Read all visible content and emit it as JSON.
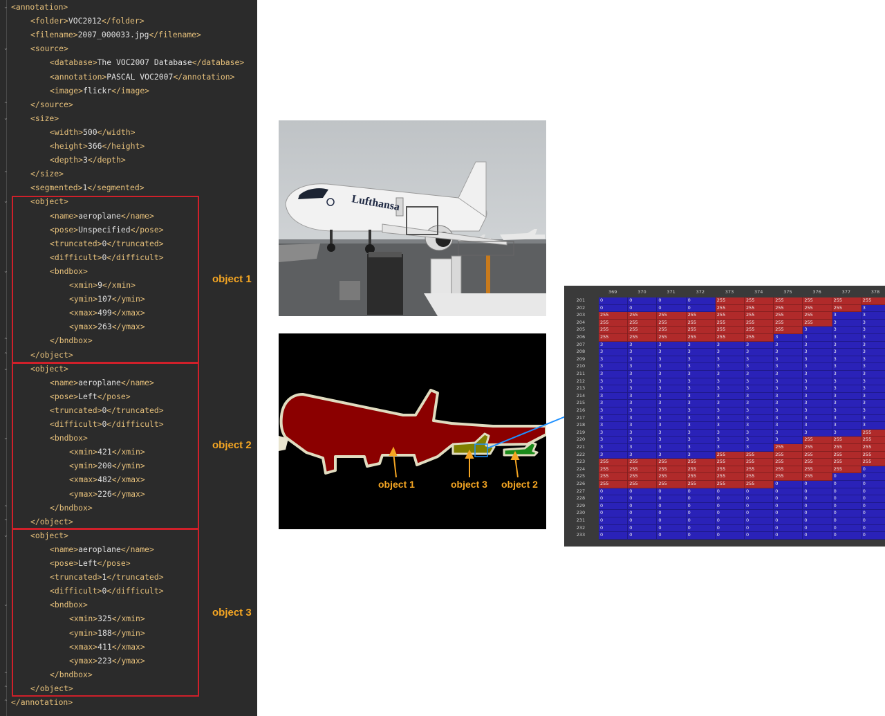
{
  "code_lines": [
    {
      "indent": 0,
      "parts": [
        [
          "tag",
          "<annotation>"
        ]
      ]
    },
    {
      "indent": 1,
      "parts": [
        [
          "tag",
          "<folder>"
        ],
        [
          "txt",
          "VOC2012"
        ],
        [
          "tag",
          "</folder>"
        ]
      ]
    },
    {
      "indent": 1,
      "parts": [
        [
          "tag",
          "<filename>"
        ],
        [
          "txt",
          "2007_000033.jpg"
        ],
        [
          "tag",
          "</filename>"
        ]
      ]
    },
    {
      "indent": 1,
      "parts": [
        [
          "tag",
          "<source>"
        ]
      ]
    },
    {
      "indent": 2,
      "parts": [
        [
          "tag",
          "<database>"
        ],
        [
          "txt",
          "The VOC2007 Database"
        ],
        [
          "tag",
          "</database>"
        ]
      ]
    },
    {
      "indent": 2,
      "parts": [
        [
          "tag",
          "<annotation>"
        ],
        [
          "txt",
          "PASCAL VOC2007"
        ],
        [
          "tag",
          "</annotation>"
        ]
      ]
    },
    {
      "indent": 2,
      "parts": [
        [
          "tag",
          "<image>"
        ],
        [
          "txt",
          "flickr"
        ],
        [
          "tag",
          "</image>"
        ]
      ]
    },
    {
      "indent": 1,
      "parts": [
        [
          "tag",
          "</source>"
        ]
      ]
    },
    {
      "indent": 1,
      "parts": [
        [
          "tag",
          "<size>"
        ]
      ]
    },
    {
      "indent": 2,
      "parts": [
        [
          "tag",
          "<width>"
        ],
        [
          "txt",
          "500"
        ],
        [
          "tag",
          "</width>"
        ]
      ]
    },
    {
      "indent": 2,
      "parts": [
        [
          "tag",
          "<height>"
        ],
        [
          "txt",
          "366"
        ],
        [
          "tag",
          "</height>"
        ]
      ]
    },
    {
      "indent": 2,
      "parts": [
        [
          "tag",
          "<depth>"
        ],
        [
          "txt",
          "3"
        ],
        [
          "tag",
          "</depth>"
        ]
      ]
    },
    {
      "indent": 1,
      "parts": [
        [
          "tag",
          "</size>"
        ]
      ]
    },
    {
      "indent": 1,
      "parts": [
        [
          "tag",
          "<segmented>"
        ],
        [
          "txt",
          "1"
        ],
        [
          "tag",
          "</segmented>"
        ]
      ]
    },
    {
      "indent": 1,
      "parts": [
        [
          "tag",
          "<object>"
        ]
      ]
    },
    {
      "indent": 2,
      "parts": [
        [
          "tag",
          "<name>"
        ],
        [
          "txt",
          "aeroplane"
        ],
        [
          "tag",
          "</name>"
        ]
      ]
    },
    {
      "indent": 2,
      "parts": [
        [
          "tag",
          "<pose>"
        ],
        [
          "txt",
          "Unspecified"
        ],
        [
          "tag",
          "</pose>"
        ]
      ]
    },
    {
      "indent": 2,
      "parts": [
        [
          "tag",
          "<truncated>"
        ],
        [
          "txt",
          "0"
        ],
        [
          "tag",
          "</truncated>"
        ]
      ]
    },
    {
      "indent": 2,
      "parts": [
        [
          "tag",
          "<difficult>"
        ],
        [
          "txt",
          "0"
        ],
        [
          "tag",
          "</difficult>"
        ]
      ]
    },
    {
      "indent": 2,
      "parts": [
        [
          "tag",
          "<bndbox>"
        ]
      ]
    },
    {
      "indent": 3,
      "parts": [
        [
          "tag",
          "<xmin>"
        ],
        [
          "txt",
          "9"
        ],
        [
          "tag",
          "</xmin>"
        ]
      ]
    },
    {
      "indent": 3,
      "parts": [
        [
          "tag",
          "<ymin>"
        ],
        [
          "txt",
          "107"
        ],
        [
          "tag",
          "</ymin>"
        ]
      ]
    },
    {
      "indent": 3,
      "parts": [
        [
          "tag",
          "<xmax>"
        ],
        [
          "txt",
          "499"
        ],
        [
          "tag",
          "</xmax>"
        ]
      ]
    },
    {
      "indent": 3,
      "parts": [
        [
          "tag",
          "<ymax>"
        ],
        [
          "txt",
          "263"
        ],
        [
          "tag",
          "</ymax>"
        ]
      ]
    },
    {
      "indent": 2,
      "parts": [
        [
          "tag",
          "</bndbox>"
        ]
      ]
    },
    {
      "indent": 1,
      "parts": [
        [
          "tag",
          "</object>"
        ]
      ]
    },
    {
      "indent": 1,
      "parts": [
        [
          "tag",
          "<object>"
        ]
      ]
    },
    {
      "indent": 2,
      "parts": [
        [
          "tag",
          "<name>"
        ],
        [
          "txt",
          "aeroplane"
        ],
        [
          "tag",
          "</name>"
        ]
      ]
    },
    {
      "indent": 2,
      "parts": [
        [
          "tag",
          "<pose>"
        ],
        [
          "txt",
          "Left"
        ],
        [
          "tag",
          "</pose>"
        ]
      ]
    },
    {
      "indent": 2,
      "parts": [
        [
          "tag",
          "<truncated>"
        ],
        [
          "txt",
          "0"
        ],
        [
          "tag",
          "</truncated>"
        ]
      ]
    },
    {
      "indent": 2,
      "parts": [
        [
          "tag",
          "<difficult>"
        ],
        [
          "txt",
          "0"
        ],
        [
          "tag",
          "</difficult>"
        ]
      ]
    },
    {
      "indent": 2,
      "parts": [
        [
          "tag",
          "<bndbox>"
        ]
      ]
    },
    {
      "indent": 3,
      "parts": [
        [
          "tag",
          "<xmin>"
        ],
        [
          "txt",
          "421"
        ],
        [
          "tag",
          "</xmin>"
        ]
      ]
    },
    {
      "indent": 3,
      "parts": [
        [
          "tag",
          "<ymin>"
        ],
        [
          "txt",
          "200"
        ],
        [
          "tag",
          "</ymin>"
        ]
      ]
    },
    {
      "indent": 3,
      "parts": [
        [
          "tag",
          "<xmax>"
        ],
        [
          "txt",
          "482"
        ],
        [
          "tag",
          "</xmax>"
        ]
      ]
    },
    {
      "indent": 3,
      "parts": [
        [
          "tag",
          "<ymax>"
        ],
        [
          "txt",
          "226"
        ],
        [
          "tag",
          "</ymax>"
        ]
      ]
    },
    {
      "indent": 2,
      "parts": [
        [
          "tag",
          "</bndbox>"
        ]
      ]
    },
    {
      "indent": 1,
      "parts": [
        [
          "tag",
          "</object>"
        ]
      ]
    },
    {
      "indent": 1,
      "parts": [
        [
          "tag",
          "<object>"
        ]
      ]
    },
    {
      "indent": 2,
      "parts": [
        [
          "tag",
          "<name>"
        ],
        [
          "txt",
          "aeroplane"
        ],
        [
          "tag",
          "</name>"
        ]
      ]
    },
    {
      "indent": 2,
      "parts": [
        [
          "tag",
          "<pose>"
        ],
        [
          "txt",
          "Left"
        ],
        [
          "tag",
          "</pose>"
        ]
      ]
    },
    {
      "indent": 2,
      "parts": [
        [
          "tag",
          "<truncated>"
        ],
        [
          "txt",
          "1"
        ],
        [
          "tag",
          "</truncated>"
        ]
      ]
    },
    {
      "indent": 2,
      "parts": [
        [
          "tag",
          "<difficult>"
        ],
        [
          "txt",
          "0"
        ],
        [
          "tag",
          "</difficult>"
        ]
      ]
    },
    {
      "indent": 2,
      "parts": [
        [
          "tag",
          "<bndbox>"
        ]
      ]
    },
    {
      "indent": 3,
      "parts": [
        [
          "tag",
          "<xmin>"
        ],
        [
          "txt",
          "325"
        ],
        [
          "tag",
          "</xmin>"
        ]
      ]
    },
    {
      "indent": 3,
      "parts": [
        [
          "tag",
          "<ymin>"
        ],
        [
          "txt",
          "188"
        ],
        [
          "tag",
          "</ymin>"
        ]
      ]
    },
    {
      "indent": 3,
      "parts": [
        [
          "tag",
          "<xmax>"
        ],
        [
          "txt",
          "411"
        ],
        [
          "tag",
          "</xmax>"
        ]
      ]
    },
    {
      "indent": 3,
      "parts": [
        [
          "tag",
          "<ymax>"
        ],
        [
          "txt",
          "223"
        ],
        [
          "tag",
          "</ymax>"
        ]
      ]
    },
    {
      "indent": 2,
      "parts": [
        [
          "tag",
          "</bndbox>"
        ]
      ]
    },
    {
      "indent": 1,
      "parts": [
        [
          "tag",
          "</object>"
        ]
      ]
    },
    {
      "indent": 0,
      "parts": [
        [
          "tag",
          "</annotation>"
        ]
      ]
    }
  ],
  "object_labels": {
    "object1": "object 1",
    "object2": "object 2",
    "object3": "object 3"
  },
  "mask_labels": {
    "object1": "object 1",
    "object2": "object 2",
    "object3": "object 3"
  },
  "pixel_table": {
    "columns": [
      "369",
      "370",
      "371",
      "372",
      "373",
      "374",
      "375",
      "376",
      "377",
      "378"
    ],
    "rows": [
      {
        "r": "201",
        "v": [
          0,
          0,
          0,
          0,
          255,
          255,
          255,
          255,
          255,
          255
        ]
      },
      {
        "r": "202",
        "v": [
          0,
          0,
          0,
          0,
          255,
          255,
          255,
          255,
          255,
          3
        ]
      },
      {
        "r": "203",
        "v": [
          255,
          255,
          255,
          255,
          255,
          255,
          255,
          255,
          3,
          3
        ]
      },
      {
        "r": "204",
        "v": [
          255,
          255,
          255,
          255,
          255,
          255,
          255,
          255,
          3,
          3
        ]
      },
      {
        "r": "205",
        "v": [
          255,
          255,
          255,
          255,
          255,
          255,
          255,
          3,
          3,
          3
        ]
      },
      {
        "r": "206",
        "v": [
          255,
          255,
          255,
          255,
          255,
          255,
          3,
          3,
          3,
          3
        ]
      },
      {
        "r": "207",
        "v": [
          3,
          3,
          3,
          3,
          3,
          3,
          3,
          3,
          3,
          3
        ]
      },
      {
        "r": "208",
        "v": [
          3,
          3,
          3,
          3,
          3,
          3,
          3,
          3,
          3,
          3
        ]
      },
      {
        "r": "209",
        "v": [
          3,
          3,
          3,
          3,
          3,
          3,
          3,
          3,
          3,
          3
        ]
      },
      {
        "r": "210",
        "v": [
          3,
          3,
          3,
          3,
          3,
          3,
          3,
          3,
          3,
          3
        ]
      },
      {
        "r": "211",
        "v": [
          3,
          3,
          3,
          3,
          3,
          3,
          3,
          3,
          3,
          3
        ]
      },
      {
        "r": "212",
        "v": [
          3,
          3,
          3,
          3,
          3,
          3,
          3,
          3,
          3,
          3
        ]
      },
      {
        "r": "213",
        "v": [
          3,
          3,
          3,
          3,
          3,
          3,
          3,
          3,
          3,
          3
        ]
      },
      {
        "r": "214",
        "v": [
          3,
          3,
          3,
          3,
          3,
          3,
          3,
          3,
          3,
          3
        ]
      },
      {
        "r": "215",
        "v": [
          3,
          3,
          3,
          3,
          3,
          3,
          3,
          3,
          3,
          3
        ]
      },
      {
        "r": "216",
        "v": [
          3,
          3,
          3,
          3,
          3,
          3,
          3,
          3,
          3,
          3
        ]
      },
      {
        "r": "217",
        "v": [
          3,
          3,
          3,
          3,
          3,
          3,
          3,
          3,
          3,
          3
        ]
      },
      {
        "r": "218",
        "v": [
          3,
          3,
          3,
          3,
          3,
          3,
          3,
          3,
          3,
          3
        ]
      },
      {
        "r": "219",
        "v": [
          3,
          3,
          3,
          3,
          3,
          3,
          3,
          3,
          3,
          255
        ]
      },
      {
        "r": "220",
        "v": [
          3,
          3,
          3,
          3,
          3,
          3,
          3,
          255,
          255,
          255
        ]
      },
      {
        "r": "221",
        "v": [
          3,
          3,
          3,
          3,
          3,
          3,
          255,
          255,
          255,
          255
        ]
      },
      {
        "r": "222",
        "v": [
          3,
          3,
          3,
          3,
          255,
          255,
          255,
          255,
          255,
          255
        ]
      },
      {
        "r": "223",
        "v": [
          255,
          255,
          255,
          255,
          255,
          255,
          255,
          255,
          255,
          255
        ]
      },
      {
        "r": "224",
        "v": [
          255,
          255,
          255,
          255,
          255,
          255,
          255,
          255,
          255,
          0
        ]
      },
      {
        "r": "225",
        "v": [
          255,
          255,
          255,
          255,
          255,
          255,
          255,
          255,
          0,
          0
        ]
      },
      {
        "r": "226",
        "v": [
          255,
          255,
          255,
          255,
          255,
          255,
          0,
          0,
          0,
          0
        ]
      },
      {
        "r": "227",
        "v": [
          0,
          0,
          0,
          0,
          0,
          0,
          0,
          0,
          0,
          0
        ]
      },
      {
        "r": "228",
        "v": [
          0,
          0,
          0,
          0,
          0,
          0,
          0,
          0,
          0,
          0
        ]
      },
      {
        "r": "229",
        "v": [
          0,
          0,
          0,
          0,
          0,
          0,
          0,
          0,
          0,
          0
        ]
      },
      {
        "r": "230",
        "v": [
          0,
          0,
          0,
          0,
          0,
          0,
          0,
          0,
          0,
          0
        ]
      },
      {
        "r": "231",
        "v": [
          0,
          0,
          0,
          0,
          0,
          0,
          0,
          0,
          0,
          0
        ]
      },
      {
        "r": "232",
        "v": [
          0,
          0,
          0,
          0,
          0,
          0,
          0,
          0,
          0,
          0
        ]
      },
      {
        "r": "233",
        "v": [
          0,
          0,
          0,
          0,
          0,
          0,
          0,
          0,
          0,
          0
        ]
      }
    ]
  },
  "colors": {
    "editor_bg": "#2b2b2b",
    "tag": "#e6c07b",
    "highlight_box": "#d0202a",
    "label_orange": "#f5a623",
    "mask_object1": "#8b0000",
    "mask_object2": "#1a8a1a",
    "mask_object3": "#808000",
    "mask_boundary": "#e0dcc0",
    "pixel_blue": "#2a22b8",
    "pixel_red": "#b02a2a",
    "pointer_blue": "#1e90ff"
  }
}
